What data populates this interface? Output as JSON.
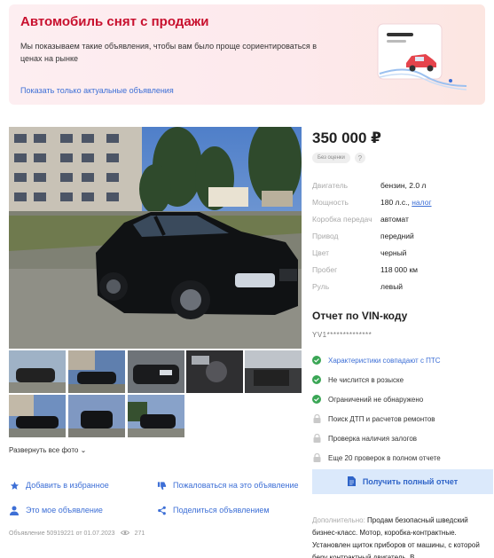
{
  "banner": {
    "title": "Автомобиль снят с продажи",
    "text": "Мы показываем такие объявления, чтобы вам было проще сориентироваться в ценах на рынке",
    "link": "Показать только актуальные объявления"
  },
  "photos": {
    "expand_label": "Развернуть все фото"
  },
  "actions": {
    "favorite": "Добавить в избранное",
    "complain": "Пожаловаться на это объявление",
    "mine": "Это мое объявление",
    "share": "Поделиться объявлением"
  },
  "meta": {
    "listing": "Объявление 50919221 от 01.07.2023",
    "views": "271"
  },
  "price": "350 000 ₽",
  "badge": "Без оценки",
  "specs": [
    {
      "key": "Двигатель",
      "value": "бензин, 2.0 л"
    },
    {
      "key": "Мощность",
      "value": "180 л.с.,",
      "link": "налог"
    },
    {
      "key": "Коробка передач",
      "value": "автомат"
    },
    {
      "key": "Привод",
      "value": "передний"
    },
    {
      "key": "Цвет",
      "value": "черный"
    },
    {
      "key": "Пробег",
      "value": "118 000 км"
    },
    {
      "key": "Руль",
      "value": "левый"
    }
  ],
  "vin": {
    "title": "Отчет по VIN-коду",
    "code": "YV1**************",
    "checks": [
      {
        "text": "Характеристики совпадают с ПТС",
        "status": "ok"
      },
      {
        "text": "Не числится в розыске",
        "status": "ok"
      },
      {
        "text": "Ограничений не обнаружено",
        "status": "ok"
      },
      {
        "text": "Поиск ДТП и расчетов ремонтов",
        "status": "locked"
      },
      {
        "text": "Проверка наличия залогов",
        "status": "locked"
      },
      {
        "text": "Еще 20 проверок в полном отчете",
        "status": "locked"
      }
    ],
    "button": "Получить полный отчет"
  },
  "description": {
    "label": "Дополнительно:",
    "text": "Продам безопасный шведский бизнес-класс. Мотор, коробка-контрактные. Установлен щиток приборов от машины, с которой беру контрактный двигатель. В"
  },
  "colors": {
    "accent": "#3d6fd6",
    "alert_title": "#c8102e",
    "check_green": "#3aa655"
  }
}
